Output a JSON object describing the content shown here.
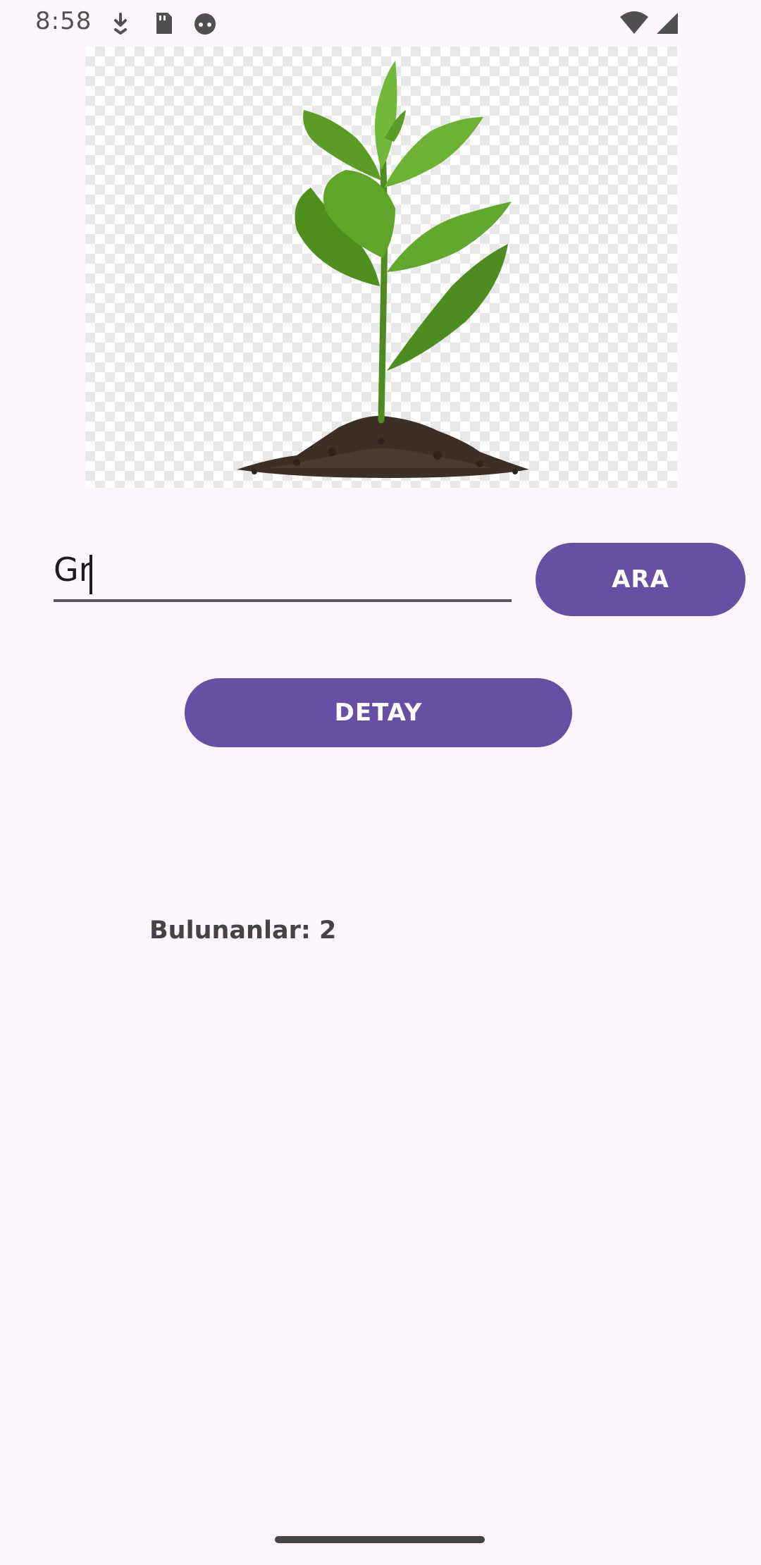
{
  "status_bar": {
    "time": "8:58",
    "icons": [
      "download-icon",
      "sd-card-icon",
      "android-face-icon",
      "wifi-icon",
      "signal-icon"
    ]
  },
  "image": {
    "subject": "plant-sprout-in-soil"
  },
  "search": {
    "value": "Gr",
    "placeholder": ""
  },
  "buttons": {
    "search_label": "ARA",
    "detail_label": "DETAY"
  },
  "results": {
    "found_text": "Bulunanlar: 2"
  },
  "colors": {
    "accent": "#6750a4",
    "background": "#fdf7fd",
    "text": "#1c1b1f"
  }
}
